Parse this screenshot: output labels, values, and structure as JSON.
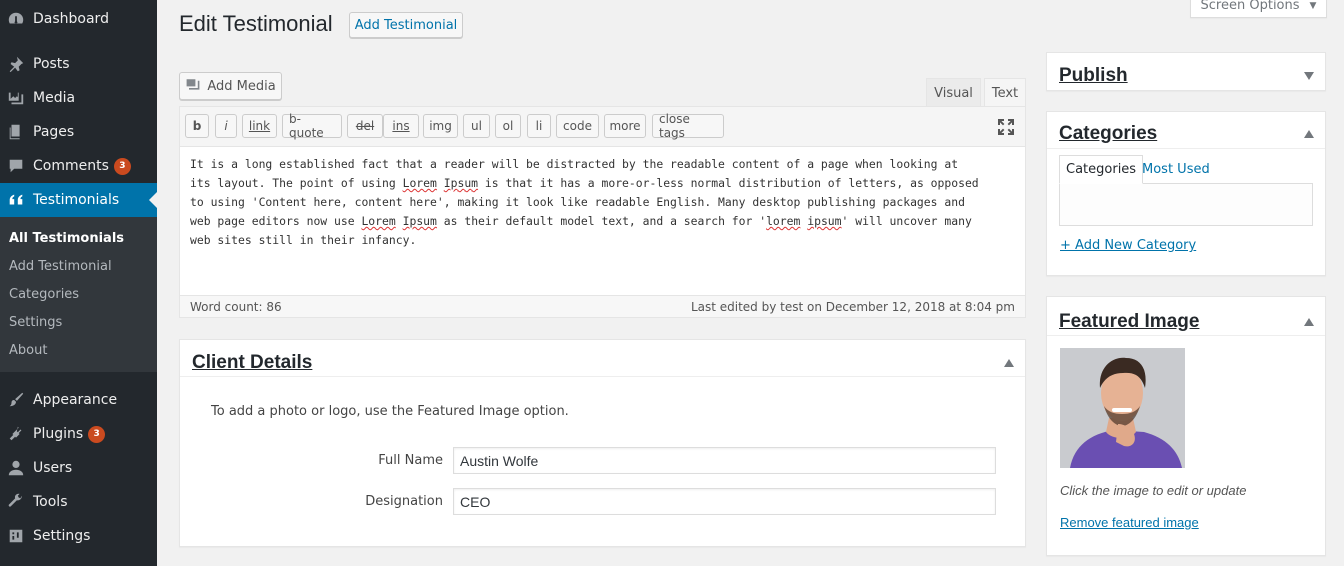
{
  "sidebar": {
    "items": [
      {
        "label": "Dashboard",
        "icon": "dashboard-icon"
      },
      {
        "label": "Posts",
        "icon": "pin-icon"
      },
      {
        "label": "Media",
        "icon": "media-icon"
      },
      {
        "label": "Pages",
        "icon": "pages-icon"
      },
      {
        "label": "Comments",
        "icon": "comment-icon",
        "badge": "3"
      },
      {
        "label": "Testimonials",
        "icon": "quote-icon",
        "current": true
      },
      {
        "label": "Appearance",
        "icon": "paintbrush-icon"
      },
      {
        "label": "Plugins",
        "icon": "plugin-icon",
        "badge": "3"
      },
      {
        "label": "Users",
        "icon": "users-icon"
      },
      {
        "label": "Tools",
        "icon": "wrench-icon"
      },
      {
        "label": "Settings",
        "icon": "settings-icon"
      }
    ],
    "submenu": [
      "All Testimonials",
      "Add Testimonial",
      "Categories",
      "Settings",
      "About"
    ]
  },
  "header": {
    "title": "Edit Testimonial",
    "add_button": "Add Testimonial",
    "screen_options": "Screen Options"
  },
  "editor": {
    "add_media": "Add Media",
    "tab_visual": "Visual",
    "tab_text": "Text",
    "quicktags": [
      "b",
      "i",
      "link",
      "b-quote",
      "del",
      "ins",
      "img",
      "ul",
      "ol",
      "li",
      "code",
      "more",
      "close tags"
    ],
    "content_parts": [
      "It is a long established fact that a reader will be distracted by the readable content of a page when looking at\nits layout. The point of using ",
      "Lorem",
      " ",
      "Ipsum",
      " is that it has a more-or-less normal distribution of letters, as opposed\nto using 'Content here, content here', making it look like readable English. Many desktop publishing packages and\nweb page editors now use ",
      "Lorem",
      " ",
      "Ipsum",
      " as their default model text, and a search for '",
      "lorem",
      " ",
      "ipsum",
      "' will uncover many\nweb sites still in their infancy."
    ],
    "word_count": "Word count: 86",
    "last_edited": "Last edited by test on December 12, 2018 at 8:04 pm"
  },
  "client_details": {
    "title": "Client Details",
    "hint": "To add a photo or logo, use the Featured Image option.",
    "full_name_label": "Full Name",
    "full_name_value": "Austin Wolfe",
    "designation_label": "Designation",
    "designation_value": "CEO"
  },
  "publish": {
    "title": "Publish"
  },
  "categories": {
    "title": "Categories",
    "tab_all": "Categories",
    "tab_popular": "Most Used",
    "add_new": "+ Add New Category"
  },
  "featured_image": {
    "title": "Featured Image",
    "caption": "Click the image to edit or update",
    "remove": "Remove featured image"
  },
  "colors": {
    "sidebar_bg": "#23282d",
    "sidebar_current": "#0073aa",
    "link": "#0073aa",
    "badge": "#ca4a1f"
  }
}
